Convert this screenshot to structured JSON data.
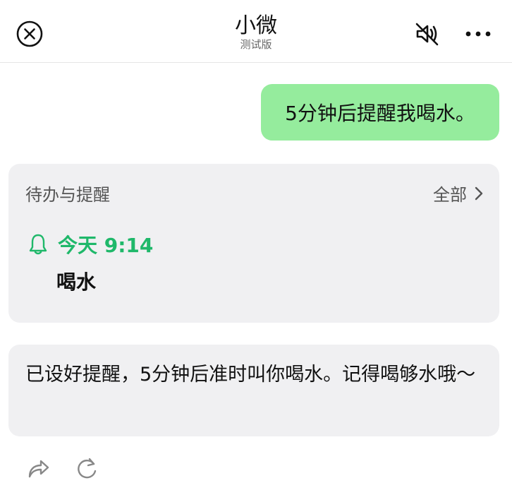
{
  "header": {
    "title": "小微",
    "subtitle": "测试版"
  },
  "messages": {
    "user": "5分钟后提醒我喝水。",
    "reply": "已设好提醒，5分钟后准时叫你喝水。记得喝够水哦～"
  },
  "todo_card": {
    "title": "待办与提醒",
    "all_label": "全部",
    "reminder": {
      "time": "今天 9:14",
      "text": "喝水"
    }
  },
  "icons": {
    "close": "close-circle-icon",
    "mute": "mute-speaker-icon",
    "more": "more-dots-icon",
    "bell": "bell-icon",
    "chevron": "chevron-right-icon",
    "share": "share-arrow-icon",
    "refresh": "refresh-icon"
  },
  "colors": {
    "user_bubble": "#95ec9d",
    "card_bg": "#f0f0f2",
    "accent_green": "#1fb86a"
  }
}
